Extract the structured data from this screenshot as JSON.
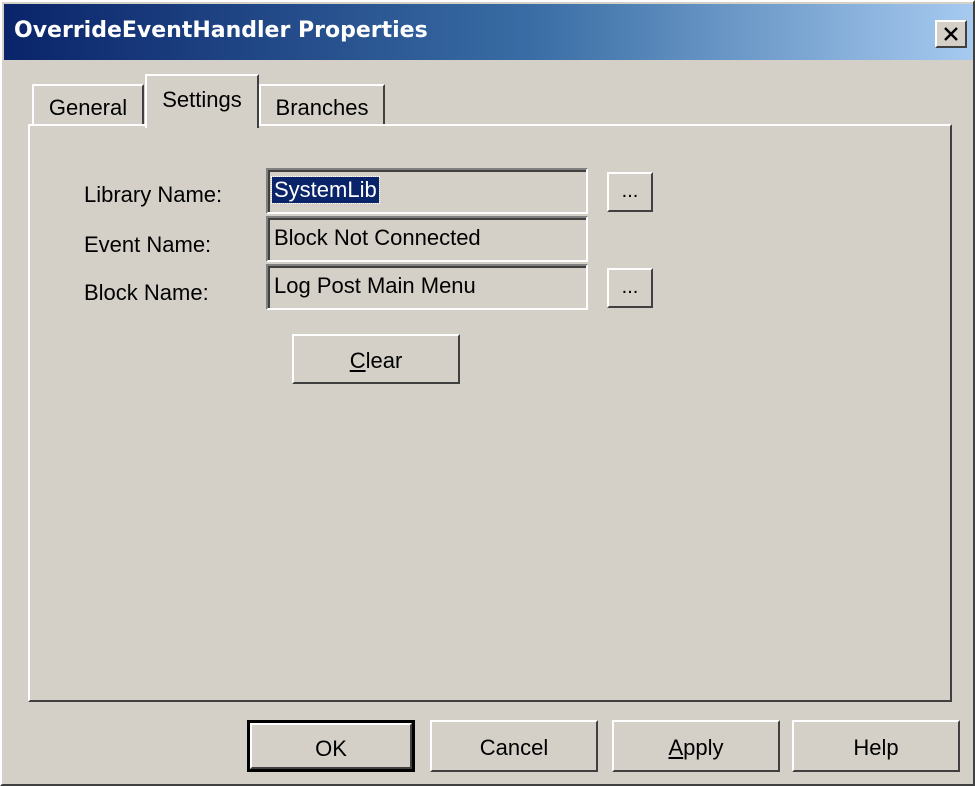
{
  "window": {
    "title": "OverrideEventHandler Properties"
  },
  "tabs": [
    {
      "label": "General"
    },
    {
      "label": "Settings",
      "active": true
    },
    {
      "label": "Branches"
    }
  ],
  "settings": {
    "library_name_label": "Library Name:",
    "library_name_value": "SystemLib",
    "event_name_label": "Event Name:",
    "event_name_value": "Block Not Connected",
    "block_name_label": "Block Name:",
    "block_name_value": "Log Post Main Menu",
    "browse_label": "...",
    "clear_mnemonic": "C",
    "clear_rest": "lear"
  },
  "buttons": {
    "ok": "OK",
    "cancel": "Cancel",
    "apply_mnemonic": "A",
    "apply_rest": "pply",
    "help": "Help"
  },
  "colors": {
    "dialog_face": "#d4d0c8",
    "titlebar_start": "#0a246a",
    "titlebar_end": "#a6caf0",
    "selection": "#0a246a"
  }
}
